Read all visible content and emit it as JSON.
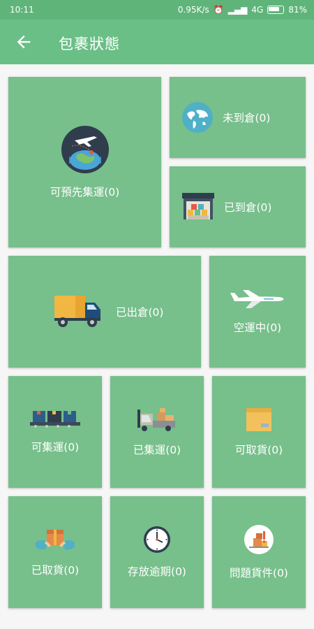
{
  "status": {
    "time": "10:11",
    "speed": "0.95K/s",
    "network": "4G",
    "battery": "81%"
  },
  "header": {
    "title": "包裹狀態",
    "back_icon": "arrow-left-icon"
  },
  "colors": {
    "primary": "#6abf86",
    "tile": "#77bf8b"
  },
  "tiles": [
    {
      "label": "可預先集運(0)",
      "icon": "globe-airplane-icon"
    },
    {
      "label": "未到倉(0)",
      "icon": "world-map-icon"
    },
    {
      "label": "已到倉(0)",
      "icon": "warehouse-icon"
    },
    {
      "label": "已出倉(0)",
      "icon": "delivery-truck-icon"
    },
    {
      "label": "空運中(0)",
      "icon": "airplane-icon"
    },
    {
      "label": "可集運(0)",
      "icon": "conveyor-boxes-icon"
    },
    {
      "label": "已集運(0)",
      "icon": "forklift-icon"
    },
    {
      "label": "可取貨(0)",
      "icon": "parcel-box-icon"
    },
    {
      "label": "已取貨(0)",
      "icon": "hands-package-icon"
    },
    {
      "label": "存放逾期(0)",
      "icon": "clock-icon"
    },
    {
      "label": "問題貨件(0)",
      "icon": "problem-parcel-icon"
    }
  ]
}
